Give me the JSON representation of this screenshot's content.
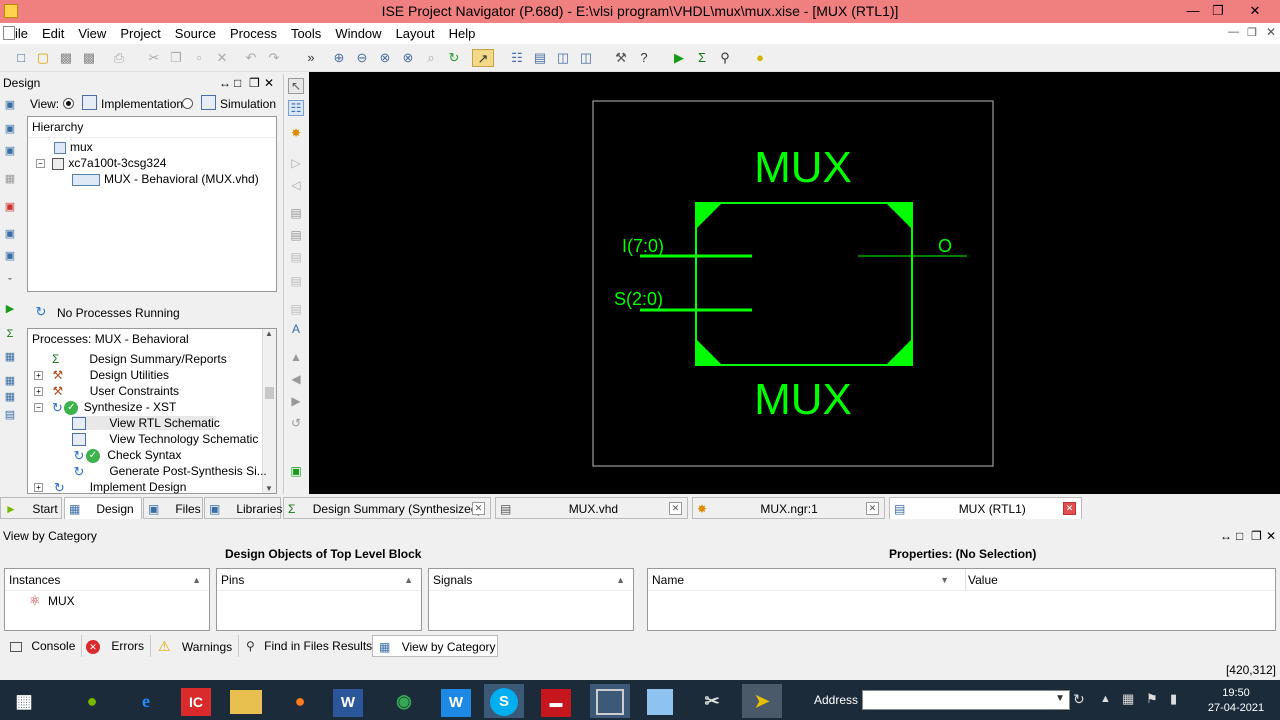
{
  "window": {
    "title": "ISE Project Navigator (P.68d) - E:\\vlsi program\\VHDL\\mux\\mux.xise - [MUX (RTL1)]"
  },
  "menu": [
    "File",
    "Edit",
    "View",
    "Project",
    "Source",
    "Process",
    "Tools",
    "Window",
    "Layout",
    "Help"
  ],
  "design_panel": {
    "title": "Design",
    "view_label": "View:",
    "impl_label": "Implementation",
    "sim_label": "Simulation",
    "hierarchy_title": "Hierarchy",
    "hierarchy": [
      "mux",
      "xc7a100t-3csg324",
      "MUX - Behavioral (MUX.vhd)"
    ],
    "process_status": "No Processes Running",
    "processes_title": "Processes: MUX - Behavioral",
    "processes": [
      "Design Summary/Reports",
      "Design Utilities",
      "User Constraints",
      "Synthesize - XST",
      "View RTL Schematic",
      "View Technology Schematic",
      "Check Syntax",
      "Generate Post-Synthesis Si...",
      "Implement Design"
    ]
  },
  "schematic": {
    "top_label": "MUX",
    "bottom_label": "MUX",
    "pin_in1": "I(7:0)",
    "pin_in2": "S(2:0)",
    "pin_out": "O"
  },
  "left_tabs": [
    "Start",
    "Design",
    "Files",
    "Libraries"
  ],
  "doc_tabs": [
    "Design Summary (Synthesized)",
    "MUX.vhd",
    "MUX.ngr:1",
    "MUX (RTL1)"
  ],
  "bottom_panel": {
    "title": "View by Category",
    "objects_title": "Design Objects of Top Level Block",
    "properties_title": "Properties: (No Selection)",
    "instances_header": "Instances",
    "instances": [
      "MUX"
    ],
    "pins_header": "Pins",
    "signals_header": "Signals",
    "name_header": "Name",
    "value_header": "Value"
  },
  "bottom_tabs": [
    "Console",
    "Errors",
    "Warnings",
    "Find in Files Results",
    "View by Category"
  ],
  "status": {
    "coords": "[420,312]"
  },
  "taskbar": {
    "address_label": "Address",
    "time": "19:50",
    "date": "27-04-2021"
  },
  "colors": {
    "titlebar": "#f08080",
    "schematic_bg": "#000000",
    "schematic_fg": "#00ff00",
    "taskbar": "#1c2b3a"
  }
}
